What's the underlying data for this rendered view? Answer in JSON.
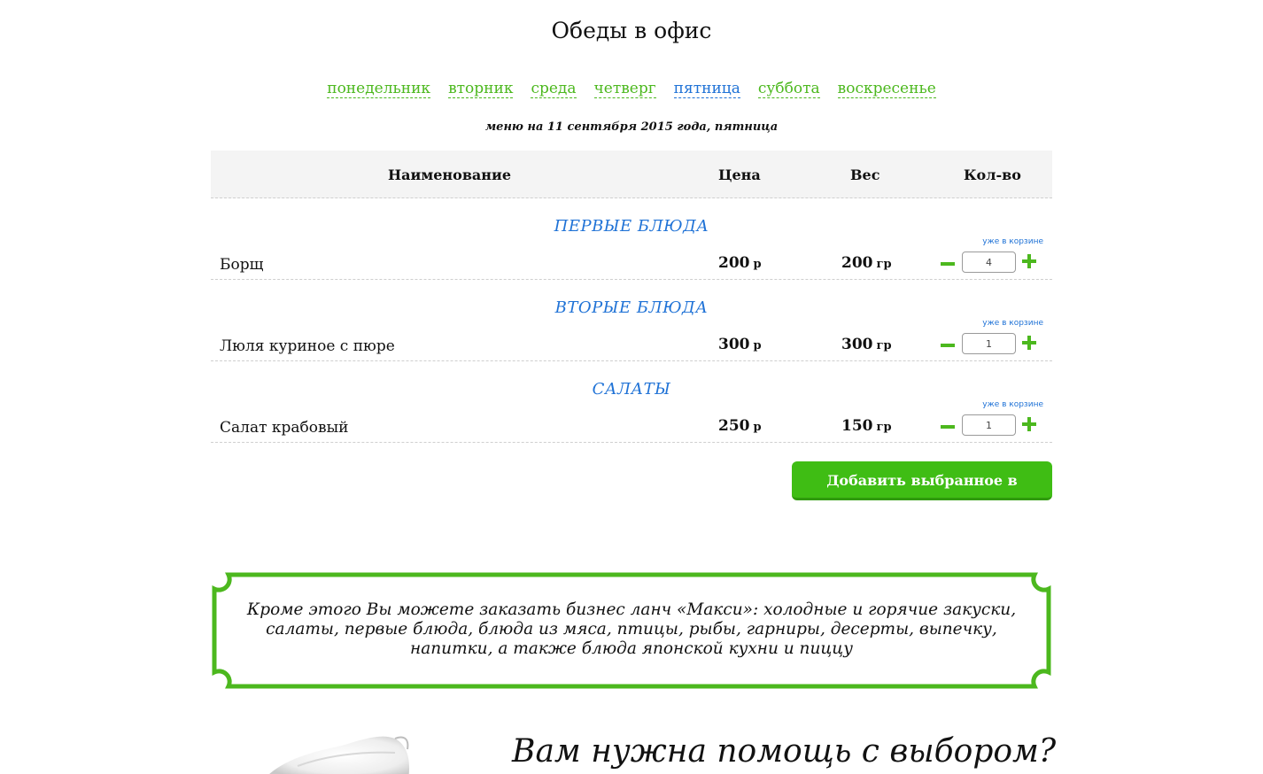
{
  "page": {
    "title": "Обеды в офис"
  },
  "days": [
    {
      "label": "понедельник",
      "active": false
    },
    {
      "label": "вторник",
      "active": false
    },
    {
      "label": "среда",
      "active": false
    },
    {
      "label": "четверг",
      "active": false
    },
    {
      "label": "пятница",
      "active": true
    },
    {
      "label": "суббота",
      "active": false
    },
    {
      "label": "воскресенье",
      "active": false
    }
  ],
  "menu": {
    "date_text": "меню на 11 сентября 2015 года, пятница",
    "headers": {
      "name": "Наименование",
      "price": "Цена",
      "weight": "Вес",
      "qty": "Кол-во"
    },
    "in_cart_label": "уже в корзине",
    "sections": [
      {
        "category": "ПЕРВЫЕ БЛЮДА",
        "dish": "Борщ",
        "price": "200",
        "price_unit": "р",
        "weight": "200",
        "weight_unit": "гр",
        "qty": "4"
      },
      {
        "category": "ВТОРЫЕ БЛЮДА",
        "dish": "Люля куриное с пюре",
        "price": "300",
        "price_unit": "р",
        "weight": "300",
        "weight_unit": "гр",
        "qty": "1"
      },
      {
        "category": "САЛАТЫ",
        "dish": "Салат крабовый",
        "price": "250",
        "price_unit": "р",
        "weight": "150",
        "weight_unit": "гр",
        "qty": "1"
      }
    ],
    "add_button_label": "Добавить выбранное в корзину"
  },
  "promo": {
    "lines": [
      "Кроме этого Вы можете заказать бизнес ланч «Макси»: холодные и горячие закуски,",
      "салаты, первые блюда, блюда из мяса, птицы, рыбы, гарниры, десерты, выпечку,",
      "напитки, а также блюда японской кухни и пиццу"
    ]
  },
  "help": {
    "title": "Вам нужна помощь с выбором?"
  },
  "colors": {
    "accent_green": "#4cb81e",
    "link_blue": "#1f72d6",
    "button_green": "#3fbd14"
  }
}
